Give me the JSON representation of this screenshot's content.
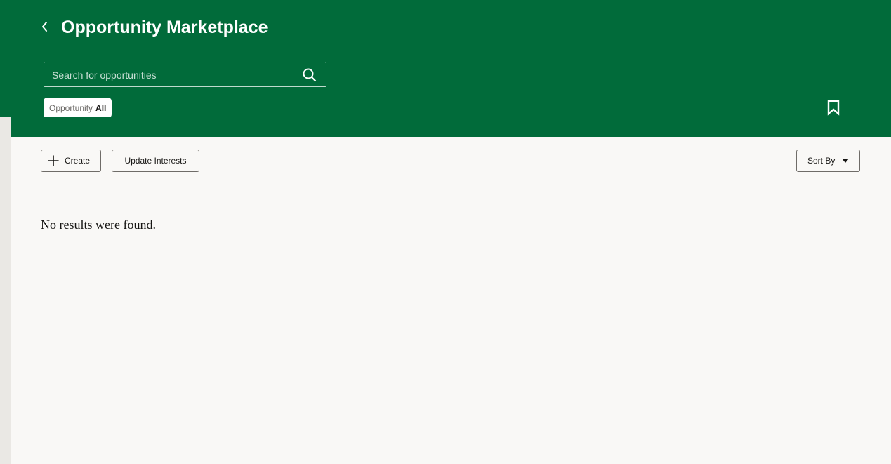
{
  "header": {
    "title": "Opportunity Marketplace",
    "back_icon": "chevron-left-icon",
    "background_color": "#016b3a"
  },
  "search": {
    "placeholder": "Search for opportunities",
    "value": "",
    "icon": "search-icon"
  },
  "filter_chip": {
    "label": "Opportunity",
    "value": "All"
  },
  "bookmark": {
    "icon": "bookmark-icon"
  },
  "toolbar": {
    "create_label": "Create",
    "create_icon": "plus-icon",
    "update_interests_label": "Update Interests",
    "sort_label": "Sort By",
    "sort_icon": "caret-down-icon"
  },
  "results": {
    "empty_message": "No results were found."
  },
  "colors": {
    "content_background": "#f9f8f6",
    "page_background": "#eae8e4",
    "text": "#161513"
  }
}
